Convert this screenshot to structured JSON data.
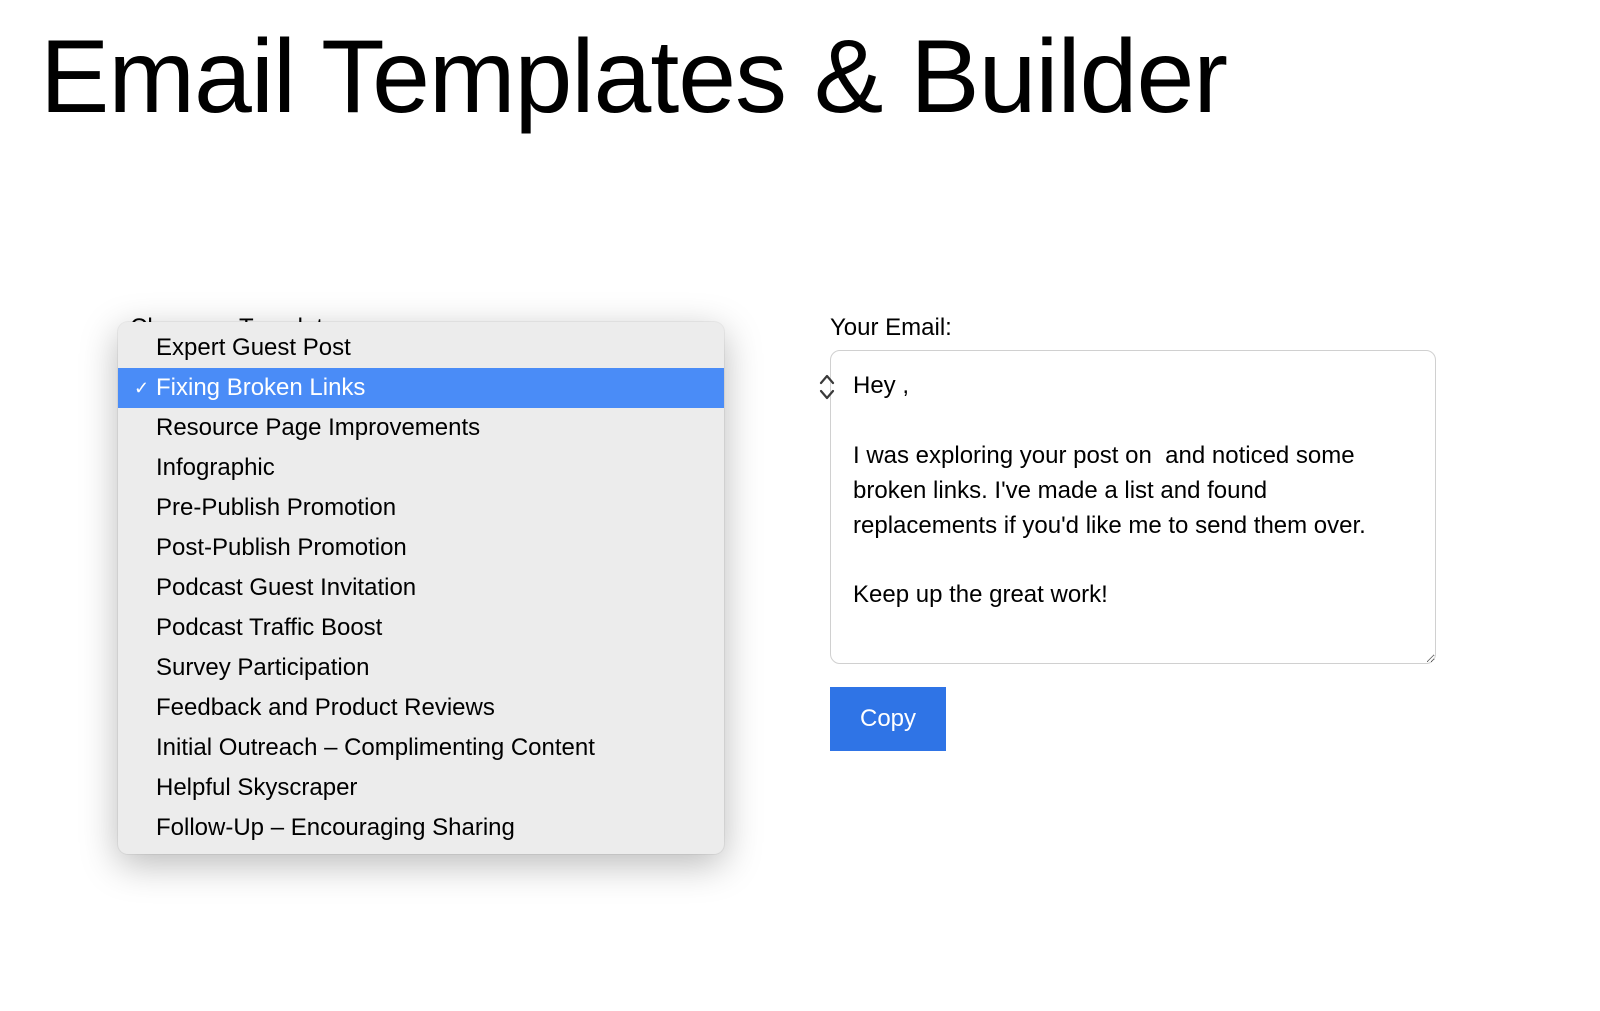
{
  "page": {
    "title": "Email Templates & Builder"
  },
  "left": {
    "label": "Choose a Template:",
    "selected_index": 1,
    "options": [
      {
        "label": "Expert Guest Post"
      },
      {
        "label": "Fixing Broken Links"
      },
      {
        "label": "Resource Page Improvements"
      },
      {
        "label": "Infographic"
      },
      {
        "label": "Pre-Publish Promotion"
      },
      {
        "label": "Post-Publish Promotion"
      },
      {
        "label": "Podcast Guest Invitation"
      },
      {
        "label": "Podcast Traffic Boost"
      },
      {
        "label": "Survey Participation"
      },
      {
        "label": "Feedback and Product Reviews"
      },
      {
        "label": "Initial Outreach – Complimenting Content"
      },
      {
        "label": "Helpful Skyscraper"
      },
      {
        "label": "Follow-Up – Encouraging Sharing"
      }
    ]
  },
  "right": {
    "label": "Your Email:",
    "email_body": "Hey ,\n\nI was exploring your post on  and noticed some broken links. I've made a list and found replacements if you'd like me to send them over.\n\nKeep up the great work!",
    "copy_label": "Copy"
  },
  "colors": {
    "accent_blue": "#2f74e6",
    "highlight_blue": "#4a8cf7",
    "panel_grey": "#ececec",
    "border_grey": "#d0d0d0"
  }
}
